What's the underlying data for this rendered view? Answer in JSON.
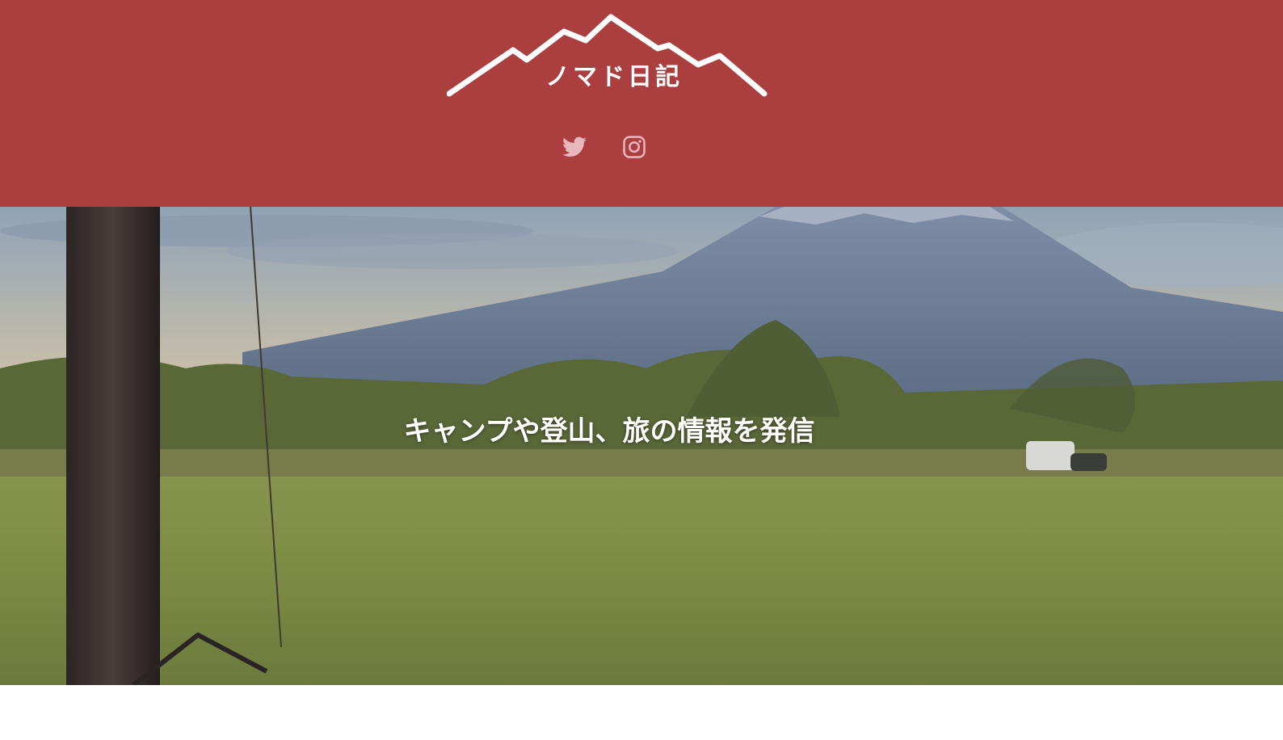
{
  "site": {
    "logo_text": "ノマド日記",
    "icons": {
      "logo": "mountain-logo-icon",
      "twitter": "twitter-bird-icon",
      "instagram": "instagram-camera-icon"
    }
  },
  "colors": {
    "header_bg": "#ab3e3f",
    "social_icon": "#e9b8bb",
    "caption_text": "#ffffff"
  },
  "hero": {
    "caption": "キャンプや登山、旅の情報を発信"
  }
}
